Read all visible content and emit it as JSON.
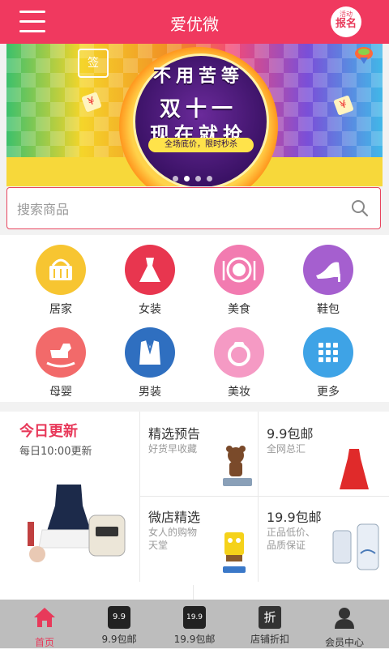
{
  "header": {
    "title": "爱优微",
    "signup_badge_top": "活动",
    "signup_badge_bottom": "报名"
  },
  "banner": {
    "line1": "不用苦等",
    "line2": "双十一",
    "line3": "现在就抢",
    "ribbon": "全场底价，限时秒杀",
    "sign_label": "签",
    "yen": "¥",
    "indicator_count": 4,
    "active_indicator": 1
  },
  "search": {
    "placeholder": "搜索商品"
  },
  "categories": [
    {
      "label": "居家",
      "icon": "basket-icon",
      "color": "#f7c531"
    },
    {
      "label": "女装",
      "icon": "dress-icon",
      "color": "#e8364f"
    },
    {
      "label": "美食",
      "icon": "plate-icon",
      "color": "#f27bb0"
    },
    {
      "label": "鞋包",
      "icon": "heel-shoe-icon",
      "color": "#a55fcf"
    },
    {
      "label": "母婴",
      "icon": "rocking-horse-icon",
      "color": "#f26a6a"
    },
    {
      "label": "男装",
      "icon": "suit-icon",
      "color": "#2f6fc0"
    },
    {
      "label": "美妆",
      "icon": "ring-icon",
      "color": "#f59ac4"
    },
    {
      "label": "更多",
      "icon": "grid-icon",
      "color": "#3ea3e6"
    }
  ],
  "promo": {
    "today_title": "今日更新",
    "today_sub": "每日10:00更新",
    "cells": [
      {
        "title": "精选预告",
        "sub": "好货早收藏"
      },
      {
        "title": "9.9包邮",
        "sub": "全网总汇"
      },
      {
        "title": "微店精选",
        "sub": "女人的购物\n天堂"
      },
      {
        "title": "19.9包邮",
        "sub": "正品低价、\n品质保证"
      }
    ]
  },
  "bottom_nav": [
    {
      "label": "首页",
      "icon": "home-icon",
      "active": true
    },
    {
      "label": "9.9包邮",
      "icon": "tag-9-9-icon",
      "icon_text": "9.9",
      "active": false
    },
    {
      "label": "19.9包邮",
      "icon": "tag-19-9-icon",
      "icon_text": "19.9",
      "active": false
    },
    {
      "label": "店铺折扣",
      "icon": "discount-icon",
      "icon_text": "折",
      "active": false
    },
    {
      "label": "会员中心",
      "icon": "user-icon",
      "active": false
    }
  ],
  "colors": {
    "brand": "#f0395f",
    "accent_text": "#e8395a"
  }
}
